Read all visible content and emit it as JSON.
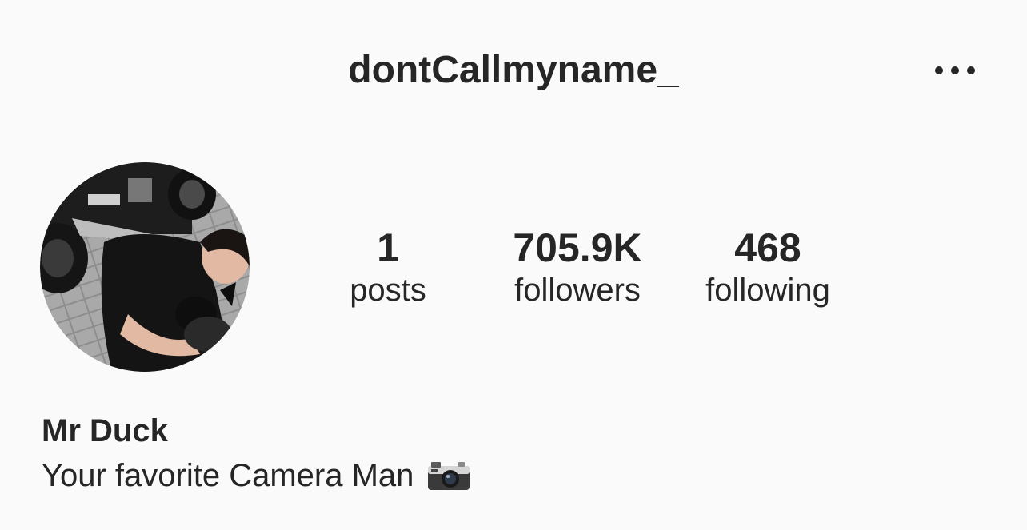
{
  "header": {
    "username": "dontCallmyname_",
    "more_icon": "ellipsis-icon"
  },
  "profile": {
    "avatar_description": "profile-photo",
    "display_name": "Mr Duck",
    "bio": "Your favorite Camera Man",
    "bio_emoji_icon": "camera-icon"
  },
  "stats": {
    "posts": {
      "count": "1",
      "label": "posts"
    },
    "followers": {
      "count": "705.9K",
      "label": "followers"
    },
    "following": {
      "count": "468",
      "label": "following"
    }
  },
  "colors": {
    "background": "#fafafa",
    "text": "#262626"
  }
}
